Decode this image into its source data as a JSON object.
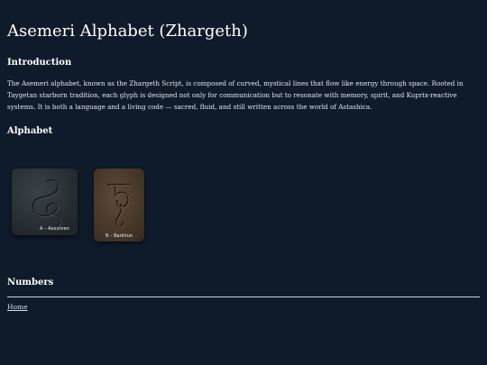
{
  "page": {
    "title": "Asemeri Alphabet (Zhargeth)"
  },
  "introduction": {
    "heading": "Introduction",
    "text": "The Asemeri alphabet, known as the Zhargeth Script, is composed of curved, mystical lines that flow like energy through space. Rooted in Taygetan starborn tradition, each glyph is designed not only for communication but to resonate with memory, spirit, and Kuprix-reactive systems. It is both a language and a living code — sacred, fluid, and still written across the world of Astashica."
  },
  "alphabet": {
    "heading": "Alphabet",
    "glyphs": [
      {
        "label": "A – Axxurven",
        "icon": "axxurven-glyph-icon",
        "color": "#2b3238"
      },
      {
        "label": "B – Barkhun",
        "icon": "barkhun-glyph-icon",
        "color": "#4a3a2d"
      }
    ]
  },
  "numbers": {
    "heading": "Numbers"
  },
  "footer": {
    "home_link": "Home"
  },
  "colors": {
    "background": "#0f1b2a",
    "text": "#e8edf3",
    "rule": "#c9d2dc"
  }
}
